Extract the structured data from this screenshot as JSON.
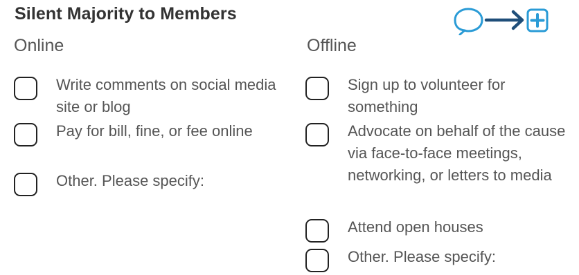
{
  "title": "Silent Majority to Members",
  "icons": {
    "speech": "speech-bubble-icon",
    "arrow": "arrow-right-icon",
    "plus": "plus-box-icon",
    "accent": "#2a9bd6"
  },
  "columns": {
    "online": {
      "heading": "Online",
      "items": [
        "Write comments on social media site or blog",
        "Pay for bill, fine, or fee online",
        "Other. Please specify:"
      ]
    },
    "offline": {
      "heading": "Offline",
      "items": [
        "Sign up to volunteer for something",
        "Advocate on behalf of the cause via face-to-face meetings, networking, or letters to media",
        "Attend open houses",
        "Other. Please specify:"
      ]
    }
  }
}
